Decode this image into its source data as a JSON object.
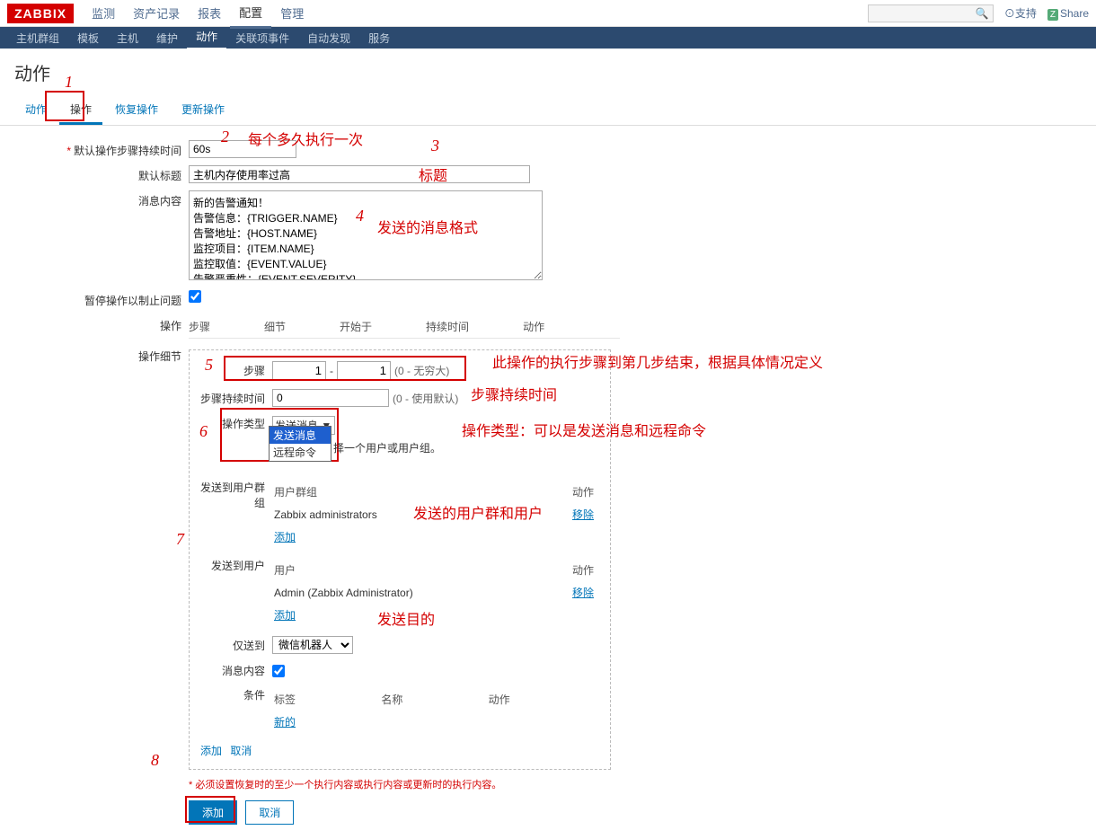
{
  "logo": "ZABBIX",
  "top_nav": {
    "monitor": "监测",
    "inventory": "资产记录",
    "reports": "报表",
    "config": "配置",
    "admin": "管理"
  },
  "top_links": {
    "support": "支持",
    "share": "Share"
  },
  "sub_nav": {
    "hostgroups": "主机群组",
    "templates": "模板",
    "hosts": "主机",
    "maintenance": "维护",
    "actions": "动作",
    "correlation": "关联项事件",
    "discovery": "自动发现",
    "services": "服务"
  },
  "page_title": "动作",
  "tabs": {
    "action": "动作",
    "operations": "操作",
    "recovery": "恢复操作",
    "update": "更新操作"
  },
  "form": {
    "step_duration_label": "默认操作步骤持续时间",
    "step_duration_value": "60s",
    "subject_label": "默认标题",
    "subject_value": "主机内存使用率过高",
    "message_label": "消息内容",
    "message_value": "新的告警通知！\n告警信息：{TRIGGER.NAME}\n告警地址：{HOST.NAME}\n监控项目：{ITEM.NAME}\n监控取值：{EVENT.VALUE}\n告警严重性：{EVENT.SEVERITY}",
    "pause_label": "暂停操作以制止问题",
    "ops_label": "操作",
    "ops_cols": {
      "step": "步骤",
      "detail": "细节",
      "start": "开始于",
      "duration": "持续时间",
      "action": "动作"
    },
    "detail_label": "操作细节",
    "step_label": "步骤",
    "step_from": "1",
    "step_to": "1",
    "step_hint": "(0 - 无穷大)",
    "dur_label": "步骤持续时间",
    "dur_value": "0",
    "dur_hint": "(0 - 使用默认)",
    "optype_label": "操作类型",
    "optype_selected": "发送消息",
    "optype_opts": {
      "send": "发送消息",
      "remote": "远程命令"
    },
    "optype_hint": "择一个用户或用户组。",
    "ug_label": "发送到用户群组",
    "ug_cols": {
      "group": "用户群组",
      "action": "动作"
    },
    "ug_row": "Zabbix administrators",
    "user_label": "发送到用户",
    "user_cols": {
      "user": "用户",
      "action": "动作"
    },
    "user_row": "Admin (Zabbix Administrator)",
    "remove": "移除",
    "add": "添加",
    "sendto_label": "仅送到",
    "sendto_value": "微信机器人",
    "msgcontent_label": "消息内容",
    "cond_label": "条件",
    "cond_cols": {
      "tag": "标签",
      "name": "名称",
      "action": "动作"
    },
    "new_link": "新的",
    "add2": "添加",
    "cancel2": "取消",
    "warn": "* 必须设置恢复时的至少一个执行内容或执行内容或更新时的执行内容。",
    "btn_add": "添加",
    "btn_cancel": "取消"
  },
  "anno": {
    "n1": "1",
    "n2": "2",
    "n3": "3",
    "n4": "4",
    "n5": "5",
    "n6": "6",
    "n7": "7",
    "n8": "8",
    "t2": "每个多久执行一次",
    "t3": "标题",
    "t4": "发送的消息格式",
    "t5a": "此操作的执行步骤到第几步结束，根据具体情况定义",
    "t5b": "步骤持续时间",
    "t6": "操作类型：可以是发送消息和远程命令",
    "t7": "发送的用户群和用户",
    "t7b": "发送目的"
  }
}
